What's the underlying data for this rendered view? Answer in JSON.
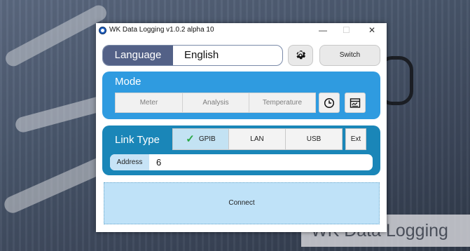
{
  "window": {
    "title": "WK Data Logging  v1.0.2 alpha 10",
    "minimize_glyph": "—",
    "maximize_glyph": "☐",
    "close_glyph": "✕"
  },
  "language": {
    "label": "Language",
    "value": "English"
  },
  "toolbar": {
    "settings_icon": "gear-icon",
    "switch_label": "Switch"
  },
  "mode": {
    "title": "Mode",
    "buttons": [
      "Meter",
      "Analysis",
      "Temperature"
    ],
    "icon_buttons": [
      "clock-icon",
      "dashboard-icon"
    ]
  },
  "link_type": {
    "title": "Link Type",
    "options": [
      "GPIB",
      "LAN",
      "USB",
      "Ext"
    ],
    "selected": "GPIB",
    "address_label": "Address",
    "address_value": "6"
  },
  "connect": {
    "label": "Connect"
  },
  "watermark": {
    "text": "WK Data Logging"
  },
  "colors": {
    "language_label_bg": "#536187",
    "mode_panel": "#2f9be0",
    "link_panel": "#1a86b8",
    "selected_option": "#c3e2f3",
    "connect_bg": "#bfe2f8",
    "check": "#2aa845"
  }
}
